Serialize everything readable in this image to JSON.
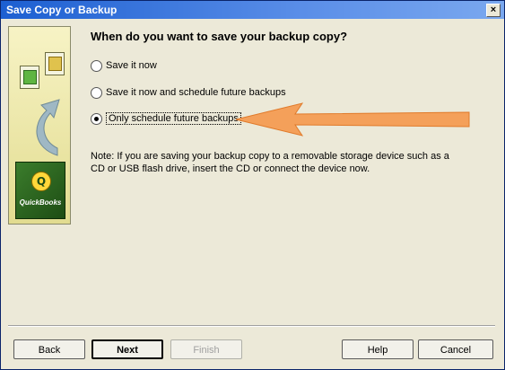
{
  "window": {
    "title": "Save Copy or Backup",
    "close_label": "×"
  },
  "side_panel": {
    "brand": "QuickBooks",
    "logo_glyph": "Q"
  },
  "question": "When do you want to save your backup copy?",
  "options": [
    {
      "label": "Save it now",
      "selected": false
    },
    {
      "label": "Save it now and schedule future backups",
      "selected": false
    },
    {
      "label": "Only schedule future backups",
      "selected": true
    }
  ],
  "note": "Note: If you are saving your backup copy to a removable storage device such as a CD or USB flash drive, insert the CD or connect the device now.",
  "buttons": {
    "back": "Back",
    "next": "Next",
    "finish": "Finish",
    "help": "Help",
    "cancel": "Cancel"
  },
  "colors": {
    "title_bar": "#1c5fd1",
    "annotation_arrow": "#f4a05a"
  }
}
